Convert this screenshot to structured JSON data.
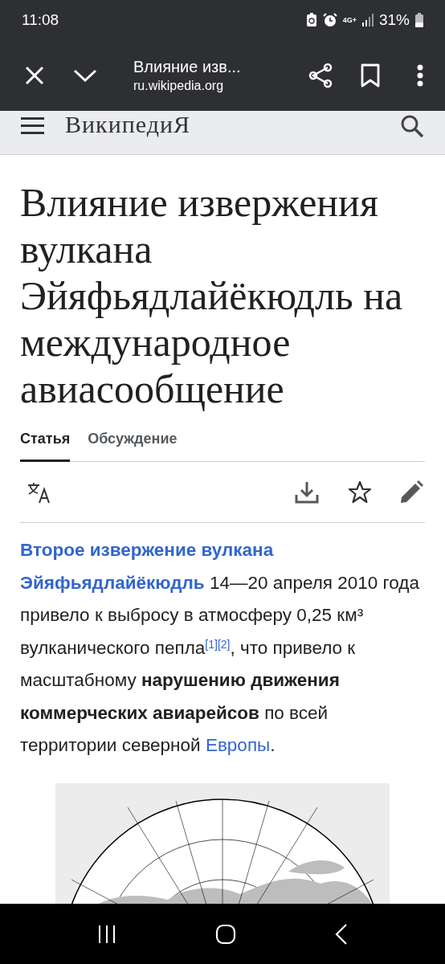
{
  "status_bar": {
    "time": "11:08",
    "network": "4G+",
    "battery": "31%"
  },
  "browser_bar": {
    "page_title": "Влияние изв...",
    "url": "ru.wikipedia.org"
  },
  "site_header": {
    "logo": "ВикипедиЯ"
  },
  "article": {
    "title": "Влияние извержения вулкана Эйяфьядлайёкюдль на международное авиасообщение",
    "tabs": [
      {
        "label": "Статья",
        "selected": true
      },
      {
        "label": "Обсуждение",
        "selected": false
      }
    ],
    "paragraph": [
      {
        "kind": "link",
        "text": "Второе извержение вулкана",
        "bold": true
      },
      {
        "kind": "link",
        "text": "Эйяфьядлайёкюдль",
        "bold": true
      },
      {
        "kind": "text",
        "text": " 14—20 апреля 2010 года привело к выбросу в атмосферу 0,25 км³ вулканического пепла"
      },
      {
        "kind": "ref",
        "text": "[1]"
      },
      {
        "kind": "ref",
        "text": "[2]"
      },
      {
        "kind": "text",
        "text": ", что привело к масштабному **нарушению движения коммерческих авиарейсов** по всей территории северной "
      },
      {
        "kind": "link",
        "text": "Европы",
        "bold": false
      },
      {
        "kind": "text",
        "text": "."
      }
    ]
  }
}
